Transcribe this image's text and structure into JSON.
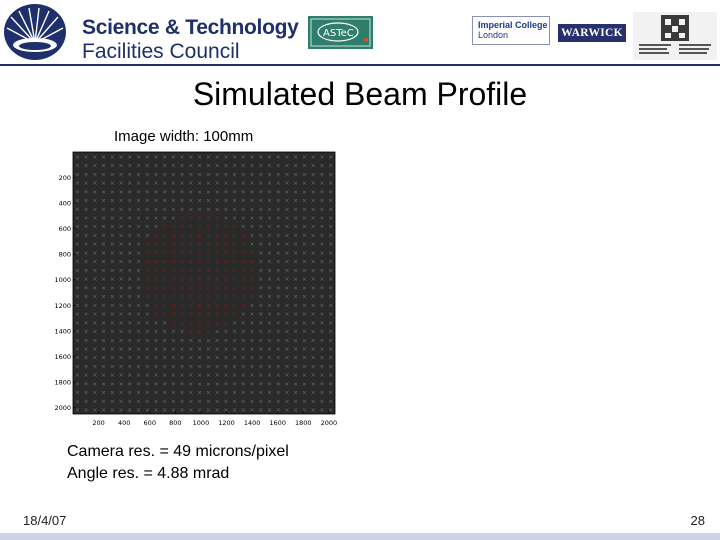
{
  "header": {
    "org_line1": "Science & Technology",
    "org_line2": "Facilities Council",
    "partner_logos": [
      {
        "name": "ASTeC",
        "icon": "astec-logo"
      },
      {
        "name": "Imperial College London",
        "line1": "Imperial College",
        "line2": "London"
      },
      {
        "name": "WARWICK"
      },
      {
        "name": "Universidad del País Vasco / Euskal Herriko Unibertsitatea",
        "icon": "ehu-logo"
      }
    ],
    "colors": {
      "brand": "#1f2f6b",
      "footer_bar": "#cdd2e6"
    }
  },
  "slide": {
    "title": "Simulated Beam Profile",
    "image_caption": "Image width: 100mm",
    "notes": [
      "Camera res. = 49 microns/pixel",
      "Angle res. = 4.88 mrad"
    ]
  },
  "chart_data": {
    "type": "heatmap",
    "title": "",
    "xlabel": "",
    "ylabel": "",
    "x_ticks": [
      "200",
      "400",
      "600",
      "800",
      "1000",
      "1200",
      "1400",
      "1600",
      "1800",
      "2000"
    ],
    "y_ticks": [
      "200",
      "400",
      "600",
      "800",
      "1000",
      "1200",
      "1400",
      "1600",
      "1800",
      "2000"
    ],
    "xlim": [
      0,
      2048
    ],
    "ylim": [
      0,
      2048
    ],
    "y_reversed": true,
    "grid_marks": "x",
    "description_colors": {
      "background": "#2a2a2a",
      "marks": "#6b6b6b",
      "beam": "#7a1f1f"
    }
  },
  "footer": {
    "date": "18/4/07",
    "page": "28"
  }
}
